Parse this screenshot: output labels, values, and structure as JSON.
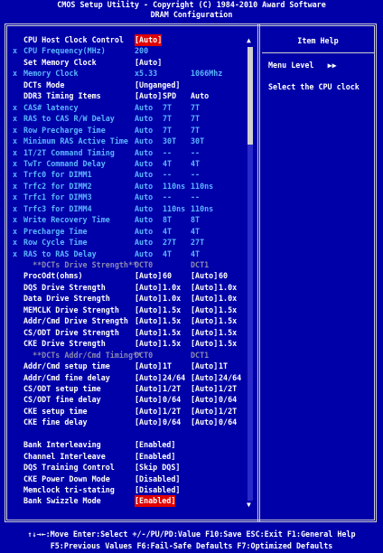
{
  "header": {
    "line1": "CMOS Setup Utility - Copyright (C) 1984-2010 Award Software",
    "line2": "DRAM Configuration"
  },
  "help": {
    "title": "Item Help",
    "menu_level_label": "Menu Level",
    "menu_level_value": "▶▶",
    "text": "Select the CPU clock"
  },
  "rows": [
    {
      "x": "",
      "label": "CPU Host Clock Control",
      "c1": "[Auto]",
      "color": "white",
      "hl": true
    },
    {
      "x": "x",
      "label": "CPU Frequency(MHz)",
      "c1": "200",
      "color": "dim"
    },
    {
      "x": "",
      "label": "Set Memory Clock",
      "c1": "[Auto]",
      "color": "white"
    },
    {
      "x": "x",
      "label": "Memory Clock",
      "c1": "x5.33",
      "c3": "1066Mhz",
      "color": "dim"
    },
    {
      "x": "",
      "label": "DCTs Mode",
      "c1": "[Unganged]",
      "color": "white"
    },
    {
      "x": "",
      "label": "DDR3 Timing Items",
      "c1": "[Auto]",
      "c2": "SPD",
      "c3": "Auto",
      "color": "white"
    },
    {
      "x": "x",
      "label": "CAS# latency",
      "c1": "Auto",
      "c2": "7T",
      "c3": "7T",
      "color": "dim"
    },
    {
      "x": "x",
      "label": "RAS to CAS R/W Delay",
      "c1": "Auto",
      "c2": "7T",
      "c3": "7T",
      "color": "dim"
    },
    {
      "x": "x",
      "label": "Row Precharge Time",
      "c1": "Auto",
      "c2": "7T",
      "c3": "7T",
      "color": "dim"
    },
    {
      "x": "x",
      "label": "Minimum RAS Active Time",
      "c1": "Auto",
      "c2": "30T",
      "c3": "30T",
      "color": "dim"
    },
    {
      "x": "x",
      "label": "1T/2T Command Timing",
      "c1": "Auto",
      "c2": "--",
      "c3": "--",
      "color": "dim"
    },
    {
      "x": "x",
      "label": "TwTr Command Delay",
      "c1": "Auto",
      "c2": "4T",
      "c3": "4T",
      "color": "dim"
    },
    {
      "x": "x",
      "label": "Trfc0 for DIMM1",
      "c1": "Auto",
      "c2": "--",
      "c3": "--",
      "color": "dim"
    },
    {
      "x": "x",
      "label": "Trfc2 for DIMM2",
      "c1": "Auto",
      "c2": "110ns",
      "c3": "110ns",
      "color": "dim"
    },
    {
      "x": "x",
      "label": "Trfc1 for DIMM3",
      "c1": "Auto",
      "c2": "--",
      "c3": "--",
      "color": "dim"
    },
    {
      "x": "x",
      "label": "Trfc3 for DIMM4",
      "c1": "Auto",
      "c2": "110ns",
      "c3": "110ns",
      "color": "dim"
    },
    {
      "x": "x",
      "label": "Write Recovery Time",
      "c1": "Auto",
      "c2": "8T",
      "c3": "8T",
      "color": "dim"
    },
    {
      "x": "x",
      "label": "Precharge Time",
      "c1": "Auto",
      "c2": "4T",
      "c3": "4T",
      "color": "dim"
    },
    {
      "x": "x",
      "label": "Row Cycle Time",
      "c1": "Auto",
      "c2": "27T",
      "c3": "27T",
      "color": "dim"
    },
    {
      "x": "x",
      "label": "RAS to RAS Delay",
      "c1": "Auto",
      "c2": "4T",
      "c3": "4T",
      "color": "dim"
    },
    {
      "x": "",
      "label": "  **DCTs Drive Strength**",
      "c1": "DCT0",
      "c3": "DCT1",
      "color": "grey"
    },
    {
      "x": "",
      "label": "ProcOdt(ohms)",
      "c1": "[Auto]",
      "c2": "60",
      "c3": "[Auto]",
      "c4": "60",
      "color": "white"
    },
    {
      "x": "",
      "label": "DQS Drive Strength",
      "c1": "[Auto]",
      "c2": "1.0x",
      "c3": "[Auto]",
      "c4": "1.0x",
      "color": "white"
    },
    {
      "x": "",
      "label": "Data Drive Strength",
      "c1": "[Auto]",
      "c2": "1.0x",
      "c3": "[Auto]",
      "c4": "1.0x",
      "color": "white"
    },
    {
      "x": "",
      "label": "MEMCLK Drive Strength",
      "c1": "[Auto]",
      "c2": "1.5x",
      "c3": "[Auto]",
      "c4": "1.5x",
      "color": "white"
    },
    {
      "x": "",
      "label": "Addr/Cmd Drive Strength",
      "c1": "[Auto]",
      "c2": "1.5x",
      "c3": "[Auto]",
      "c4": "1.5x",
      "color": "white"
    },
    {
      "x": "",
      "label": "CS/ODT Drive Strength",
      "c1": "[Auto]",
      "c2": "1.5x",
      "c3": "[Auto]",
      "c4": "1.5x",
      "color": "white"
    },
    {
      "x": "",
      "label": "CKE Drive Strength",
      "c1": "[Auto]",
      "c2": "1.5x",
      "c3": "[Auto]",
      "c4": "1.5x",
      "color": "white"
    },
    {
      "x": "",
      "label": "  **DCTs Addr/Cmd Timing**",
      "c1": "DCT0",
      "c3": "DCT1",
      "color": "grey"
    },
    {
      "x": "",
      "label": "Addr/Cmd setup time",
      "c1": "[Auto]",
      "c2": "1T",
      "c3": "[Auto]",
      "c4": "1T",
      "color": "white"
    },
    {
      "x": "",
      "label": "Addr/Cmd fine delay",
      "c1": "[Auto]",
      "c2": "24/64",
      "c3": "[Auto]",
      "c4": "24/64",
      "color": "white"
    },
    {
      "x": "",
      "label": "CS/ODT setup time",
      "c1": "[Auto]",
      "c2": "1/2T",
      "c3": "[Auto]",
      "c4": "1/2T",
      "color": "white"
    },
    {
      "x": "",
      "label": "CS/ODT fine delay",
      "c1": "[Auto]",
      "c2": "0/64",
      "c3": "[Auto]",
      "c4": "0/64",
      "color": "white"
    },
    {
      "x": "",
      "label": "CKE setup time",
      "c1": "[Auto]",
      "c2": "1/2T",
      "c3": "[Auto]",
      "c4": "1/2T",
      "color": "white"
    },
    {
      "x": "",
      "label": "CKE fine delay",
      "c1": "[Auto]",
      "c2": "0/64",
      "c3": "[Auto]",
      "c4": "0/64",
      "color": "white"
    },
    {
      "x": "",
      "label": "",
      "color": "white"
    },
    {
      "x": "",
      "label": "Bank Interleaving",
      "c1": "[Enabled]",
      "color": "white"
    },
    {
      "x": "",
      "label": "Channel Interleave",
      "c1": "[Enabled]",
      "color": "white"
    },
    {
      "x": "",
      "label": "DQS Training Control",
      "c1": "[Skip DQS]",
      "color": "white"
    },
    {
      "x": "",
      "label": "CKE Power Down Mode",
      "c1": "[Disabled]",
      "color": "white"
    },
    {
      "x": "",
      "label": "Memclock tri-stating",
      "c1": "[Disabled]",
      "color": "white"
    },
    {
      "x": "",
      "label": "Bank Swizzle Mode",
      "c1": "[Enabled]",
      "color": "white",
      "hl": true
    }
  ],
  "footer": {
    "line1": "↑↓→←:Move  Enter:Select  +/-/PU/PD:Value  F10:Save  ESC:Exit  F1:General Help",
    "line2": "F5:Previous Values  F6:Fail-Safe Defaults  F7:Optimized Defaults"
  },
  "colors": {
    "background": "#0000a8",
    "highlight": "#e00000",
    "dim": "#5bb5ff",
    "text": "#ffffff"
  }
}
